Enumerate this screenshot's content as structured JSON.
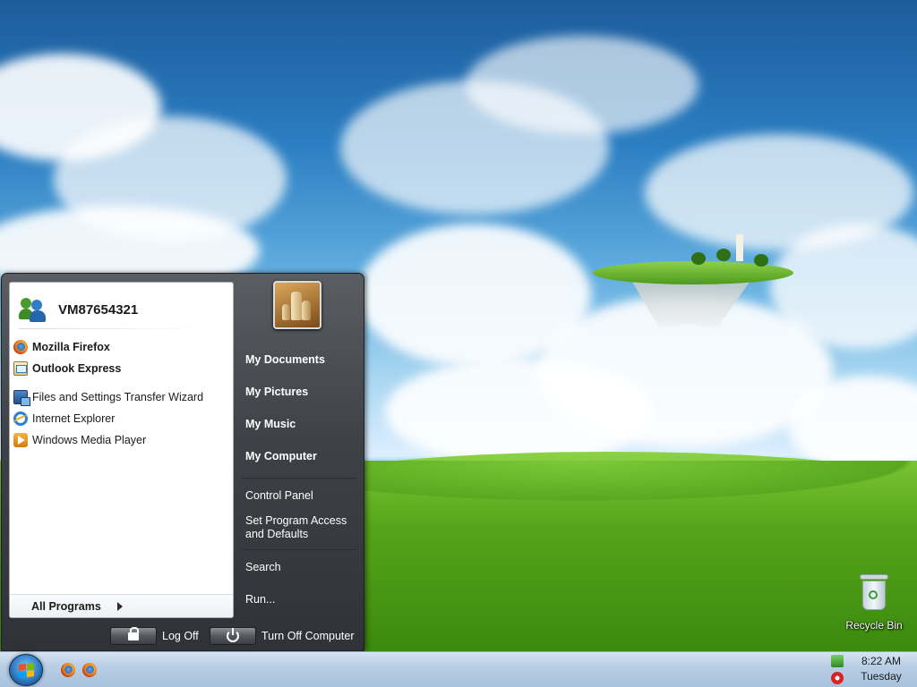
{
  "desktop": {
    "recycle_bin_label": "Recycle Bin"
  },
  "start_menu": {
    "user_name": "VM87654321",
    "pinned": [
      {
        "label": "Mozilla Firefox",
        "icon": "firefox-icon"
      },
      {
        "label": "Outlook Express",
        "icon": "outlook-express-icon"
      }
    ],
    "recent": [
      {
        "label": "Files and Settings Transfer Wizard",
        "icon": "transfer-wizard-icon"
      },
      {
        "label": "Internet Explorer",
        "icon": "internet-explorer-icon"
      },
      {
        "label": "Windows Media Player",
        "icon": "media-player-icon"
      }
    ],
    "all_programs_label": "All Programs",
    "places": {
      "my_documents": "My Documents",
      "my_pictures": "My Pictures",
      "my_music": "My Music",
      "my_computer": "My Computer",
      "control_panel": "Control Panel",
      "set_program_access_line1": "Set Program Access",
      "set_program_access_line2": "and Defaults",
      "search": "Search",
      "run": "Run..."
    },
    "log_off_label": "Log Off",
    "turn_off_label": "Turn Off Computer"
  },
  "taskbar": {
    "quick_launch": [
      "firefox-icon",
      "firefox-icon"
    ],
    "clock_time": "8:22 AM",
    "clock_day": "Tuesday"
  },
  "colors": {
    "taskbar_top": "#d6e4f2",
    "menu_dark": "#3e4246",
    "orb_blue": "#2f7cc4"
  }
}
